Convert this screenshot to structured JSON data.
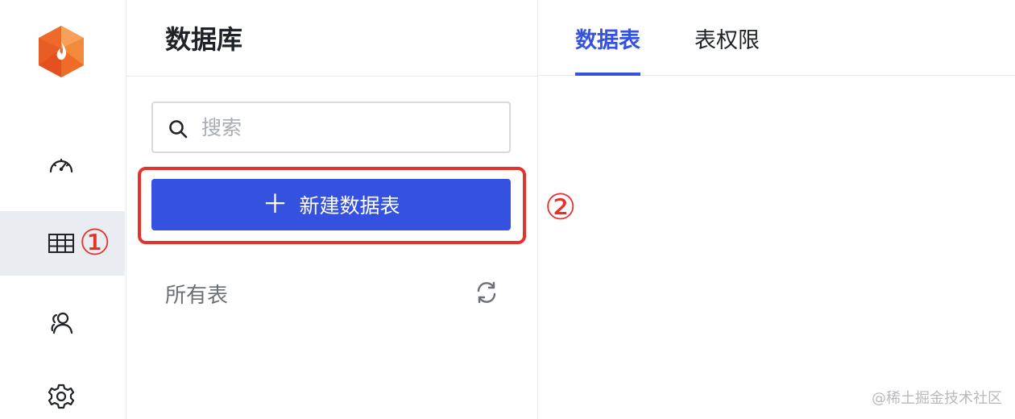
{
  "rail": {
    "items": [
      {
        "icon": "dashboard-icon"
      },
      {
        "icon": "table-icon",
        "active": true
      },
      {
        "icon": "users-icon"
      },
      {
        "icon": "gear-icon"
      }
    ]
  },
  "annotations": {
    "one": "①",
    "two": "②"
  },
  "panel": {
    "title": "数据库",
    "search_placeholder": "搜索",
    "new_table_label": "新建数据表",
    "new_table_plus": "＋",
    "section_label": "所有表"
  },
  "tabs": [
    {
      "label": "数据表",
      "active": true
    },
    {
      "label": "表权限",
      "active": false
    }
  ],
  "watermark": "@稀土掘金技术社区",
  "colors": {
    "accent": "#3451e0",
    "annotation": "#e5322b",
    "logo_orange": "#f26b2a"
  }
}
